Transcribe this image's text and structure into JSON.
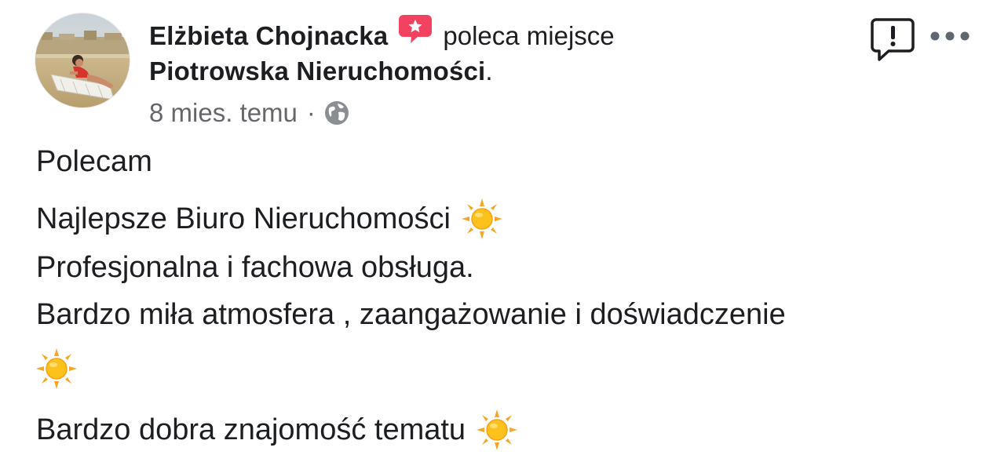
{
  "post": {
    "author_name": "Elżbieta Chojnacka",
    "action_text": "poleca miejsce",
    "page_name": "Piotrowska Nieruchomości",
    "page_name_suffix": ".",
    "timestamp": "8 mies. temu",
    "separator": "·",
    "privacy_icon": "globe-icon",
    "recommend_icon": "recommendation-star-icon",
    "lines": [
      "Polecam",
      "Najlepsze Biuro Nieruchomości",
      "Profesjonalna i fachowa obsługa.",
      "Bardzo miła atmosfera , zaangażowanie i doświadczenie",
      "Bardzo dobra znajomość tematu"
    ],
    "emoji": "sun-emoji"
  },
  "actions": {
    "report_icon": "report-icon",
    "more_icon": "more-options-icon"
  },
  "colors": {
    "text_primary": "#1c1e21",
    "text_secondary": "#65676b",
    "recommend_badge": "#f3425f",
    "icon_dark": "#1c1e21"
  }
}
